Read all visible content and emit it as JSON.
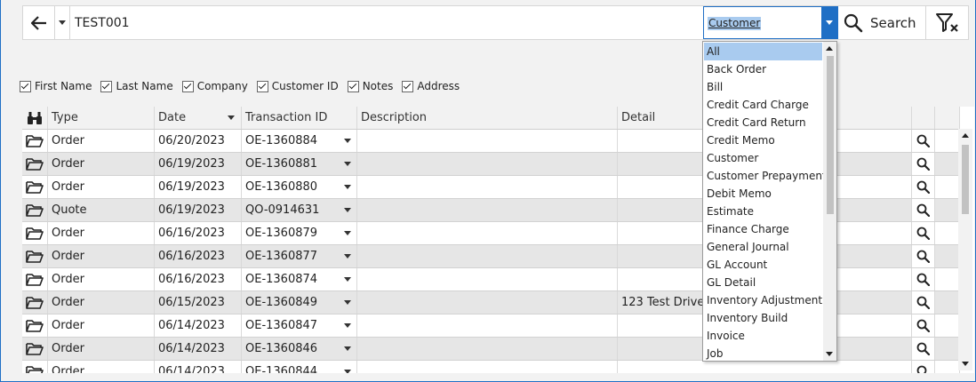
{
  "search": {
    "query": "TEST001",
    "type_selected": "Customer",
    "search_label": "Search"
  },
  "filters": [
    {
      "label": "First Name",
      "checked": true
    },
    {
      "label": "Last Name",
      "checked": true
    },
    {
      "label": "Company",
      "checked": true
    },
    {
      "label": "Customer ID",
      "checked": true
    },
    {
      "label": "Notes",
      "checked": true
    },
    {
      "label": "Address",
      "checked": true
    }
  ],
  "grid": {
    "headers": {
      "type": "Type",
      "date": "Date",
      "transaction_id": "Transaction ID",
      "description": "Description",
      "detail": "Detail"
    },
    "rows": [
      {
        "type": "Order",
        "date": "06/20/2023",
        "tid": "OE-1360884",
        "description": "",
        "detail": ""
      },
      {
        "type": "Order",
        "date": "06/19/2023",
        "tid": "OE-1360881",
        "description": "",
        "detail": ""
      },
      {
        "type": "Order",
        "date": "06/19/2023",
        "tid": "OE-1360880",
        "description": "",
        "detail": ""
      },
      {
        "type": "Quote",
        "date": "06/19/2023",
        "tid": "QO-0914631",
        "description": "",
        "detail": ""
      },
      {
        "type": "Order",
        "date": "06/16/2023",
        "tid": "OE-1360879",
        "description": "",
        "detail": ""
      },
      {
        "type": "Order",
        "date": "06/16/2023",
        "tid": "OE-1360877",
        "description": "",
        "detail": ""
      },
      {
        "type": "Order",
        "date": "06/16/2023",
        "tid": "OE-1360874",
        "description": "",
        "detail": ""
      },
      {
        "type": "Order",
        "date": "06/15/2023",
        "tid": "OE-1360849",
        "description": "",
        "detail": "123 Test Drive,"
      },
      {
        "type": "Order",
        "date": "06/14/2023",
        "tid": "OE-1360847",
        "description": "",
        "detail": ""
      },
      {
        "type": "Order",
        "date": "06/14/2023",
        "tid": "OE-1360846",
        "description": "",
        "detail": ""
      },
      {
        "type": "Order",
        "date": "06/14/2023",
        "tid": "OE-1360844",
        "description": "",
        "detail": ""
      }
    ]
  },
  "type_dropdown": {
    "selected": "All",
    "options": [
      "All",
      "Back Order",
      "Bill",
      "Credit Card Charge",
      "Credit Card Return",
      "Credit Memo",
      "Customer",
      "Customer Prepayment",
      "Debit Memo",
      "Estimate",
      "Finance Charge",
      "General Journal",
      "GL Account",
      "GL Detail",
      "Inventory Adjustment",
      "Inventory Build",
      "Invoice",
      "Job"
    ]
  },
  "colors": {
    "accent": "#1f6fc5",
    "selection": "#a9cbef",
    "row_alt": "#e6e6e6"
  },
  "icons": {
    "back": "arrow-left-icon",
    "history": "caret-down-icon",
    "search": "magnifier-icon",
    "clear_filter": "filter-clear-icon",
    "header": "binoculars-icon",
    "row_open": "folder-open-icon",
    "row_detail": "magnifier-icon"
  }
}
